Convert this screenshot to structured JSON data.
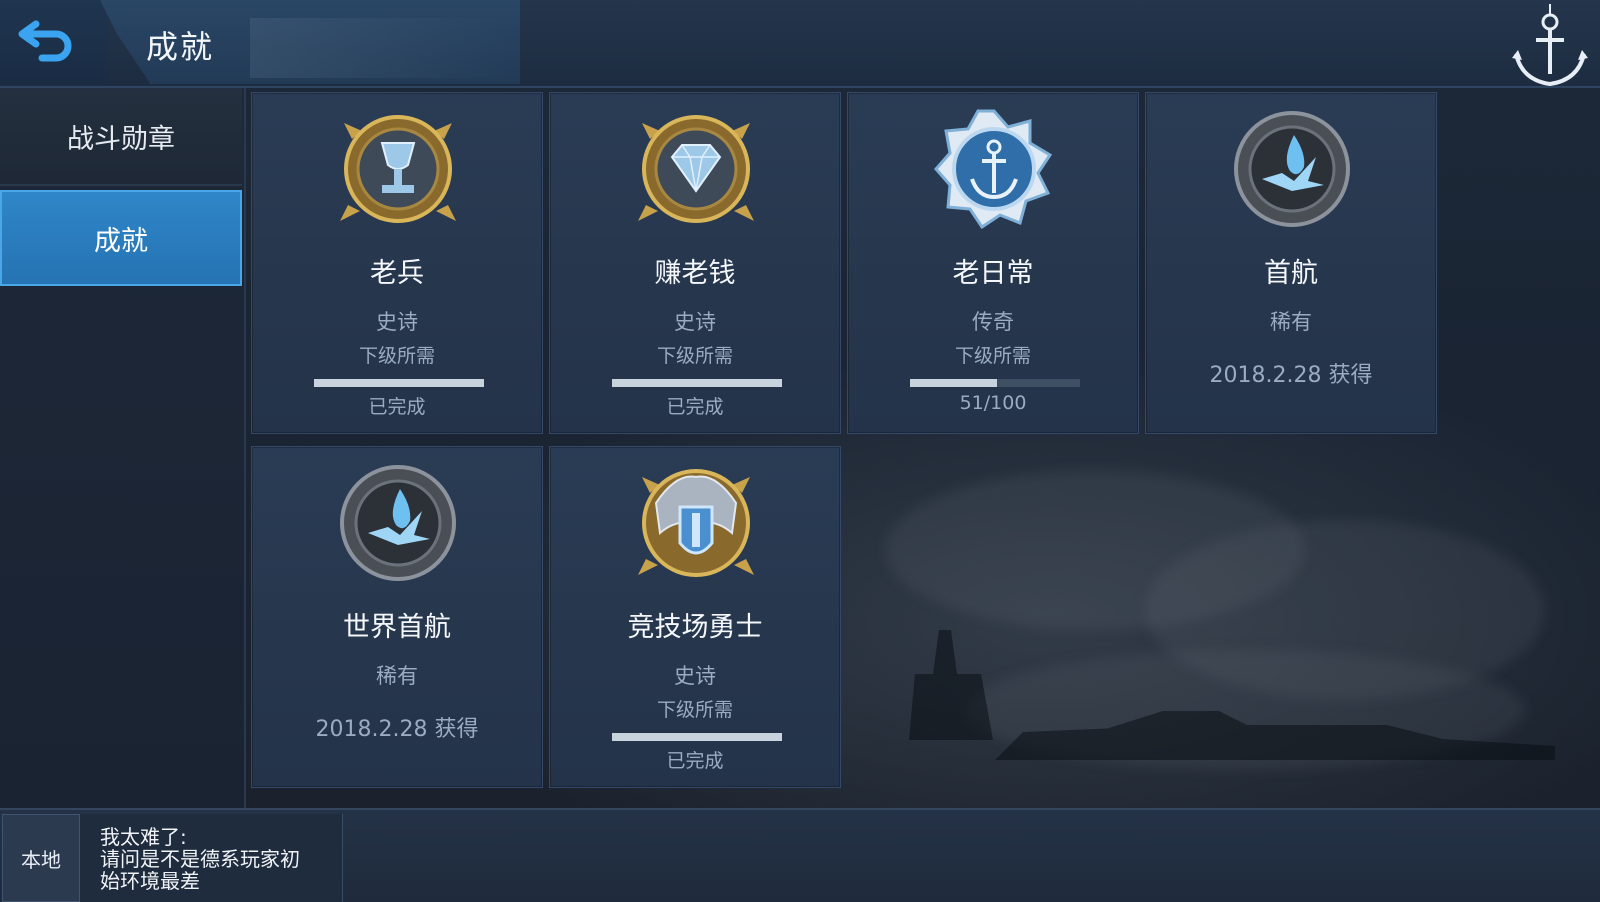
{
  "header": {
    "title": "成就",
    "back_icon": "back-arrow-icon",
    "corner_icon": "anchor-icon"
  },
  "sidebar": {
    "items": [
      {
        "label": "战斗勋章",
        "active": false
      },
      {
        "label": "成就",
        "active": true
      }
    ]
  },
  "achievements": [
    {
      "name": "老兵",
      "rarity": "史诗",
      "requirement": "下级所需",
      "progress": 1.0,
      "status": "已完成",
      "icon": "trophy-medal-icon"
    },
    {
      "name": "赚老钱",
      "rarity": "史诗",
      "requirement": "下级所需",
      "progress": 1.0,
      "status": "已完成",
      "icon": "diamond-medal-icon"
    },
    {
      "name": "老日常",
      "rarity": "传奇",
      "requirement": "下级所需",
      "progress": 0.51,
      "status": "51/100",
      "icon": "anchor-medal-icon"
    },
    {
      "name": "首航",
      "rarity": "稀有",
      "date": "2018.2.28 获得",
      "icon": "splash-medal-icon"
    },
    {
      "name": "世界首航",
      "rarity": "稀有",
      "date": "2018.2.28 获得",
      "icon": "splash-medal-icon"
    },
    {
      "name": "竞技场勇士",
      "rarity": "史诗",
      "requirement": "下级所需",
      "progress": 1.0,
      "status": "已完成",
      "icon": "eagle-shield-medal-icon"
    }
  ],
  "chat": {
    "channel_label": "本地",
    "message_line1": "我太难了:",
    "message_line2": "请问是不是德系玩家初",
    "message_line3": "始环境最差"
  },
  "colors": {
    "accent": "#2f86c8",
    "card_bg": "#26364c",
    "text_muted": "#9aabc2",
    "progress_fill": "#c9d3dd"
  }
}
